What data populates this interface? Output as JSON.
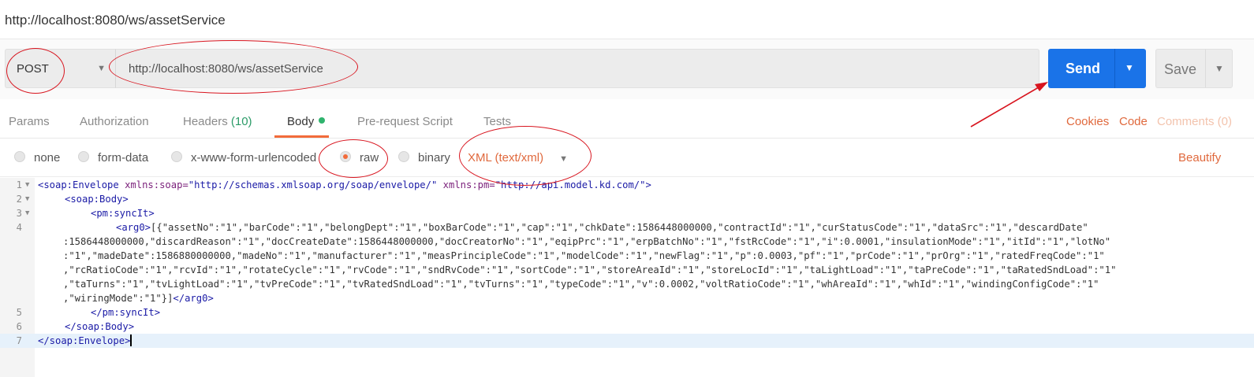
{
  "window": {
    "title": "http://localhost:8080/ws/assetService"
  },
  "request": {
    "method": "POST",
    "url": "http://localhost:8080/ws/assetService",
    "send_label": "Send",
    "save_label": "Save"
  },
  "tabs": {
    "params": "Params",
    "authorization": "Authorization",
    "headers": "Headers",
    "headers_count": "(10)",
    "body": "Body",
    "prerequest": "Pre-request Script",
    "tests": "Tests"
  },
  "right_links": {
    "cookies": "Cookies",
    "code": "Code",
    "comments": "Comments (0)"
  },
  "body_types": {
    "none": "none",
    "form_data": "form-data",
    "urlencoded": "x-www-form-urlencoded",
    "raw": "raw",
    "binary": "binary",
    "selected": "raw",
    "content_type": "XML (text/xml)",
    "beautify": "Beautify"
  },
  "editor": {
    "line_numbers": [
      "1",
      "2",
      "3",
      "4",
      "5",
      "6",
      "7"
    ],
    "line1": {
      "open": "<soap:Envelope",
      "attr1": " xmlns:soap=",
      "val1": "\"http://schemas.xmlsoap.org/soap/envelope/\"",
      "attr2": " xmlns:pm=",
      "val2": "\"http://api.model.kd.com/\"",
      "close": ">"
    },
    "line2": "<soap:Body>",
    "line3": "<pm:syncIt>",
    "line4_tag": "<arg0>",
    "line4_text": [
      "[{\"assetNo\":\"1\",\"barCode\":\"1\",\"belongDept\":\"1\",\"boxBarCode\":\"1\",\"cap\":\"1\",\"chkDate\":1586448000000,\"contractId\":\"1\",\"curStatusCode\":\"1\",\"dataSrc\":\"1\",\"descardDate\"",
      ":1586448000000,\"discardReason\":\"1\",\"docCreateDate\":1586448000000,\"docCreatorNo\":\"1\",\"eqipPrc\":\"1\",\"erpBatchNo\":\"1\",\"fstRcCode\":\"1\",\"i\":0.0001,\"insulationMode\":\"1\",\"itId\":\"1\",\"lotNo\"",
      ":\"1\",\"madeDate\":1586880000000,\"madeNo\":\"1\",\"manufacturer\":\"1\",\"measPrincipleCode\":\"1\",\"modelCode\":\"1\",\"newFlag\":\"1\",\"p\":0.0003,\"pf\":\"1\",\"prCode\":\"1\",\"prOrg\":\"1\",\"ratedFreqCode\":\"1\"",
      ",\"rcRatioCode\":\"1\",\"rcvId\":\"1\",\"rotateCycle\":\"1\",\"rvCode\":\"1\",\"sndRvCode\":\"1\",\"sortCode\":\"1\",\"storeAreaId\":\"1\",\"storeLocId\":\"1\",\"taLightLoad\":\"1\",\"taPreCode\":\"1\",\"taRatedSndLoad\":\"1\"",
      ",\"taTurns\":\"1\",\"tvLightLoad\":\"1\",\"tvPreCode\":\"1\",\"tvRatedSndLoad\":\"1\",\"tvTurns\":\"1\",\"typeCode\":\"1\",\"v\":0.0002,\"voltRatioCode\":\"1\",\"whAreaId\":\"1\",\"whId\":\"1\",\"windingConfigCode\":\"1\"",
      ",\"wiringMode\":\"1\"}]"
    ],
    "line4_close": "</arg0>",
    "line5": "</pm:syncIt>",
    "line6": "</soap:Body>",
    "line7": "</soap:Envelope>"
  },
  "colors": {
    "send": "#1a73e8",
    "accent": "#f26b3a",
    "link": "#e0693d",
    "tag": "#1a1aa6",
    "attr": "#7a1f7a",
    "annotation": "#d8141e",
    "headers_count": "#2b9b68",
    "status_dot": "#2fb36d"
  },
  "icons": {
    "method_dropdown": "chevron-down-icon",
    "send_dropdown": "chevron-down-icon",
    "save_dropdown": "chevron-down-icon",
    "content_type_dropdown": "chevron-down-icon",
    "body_status": "dot-icon"
  }
}
